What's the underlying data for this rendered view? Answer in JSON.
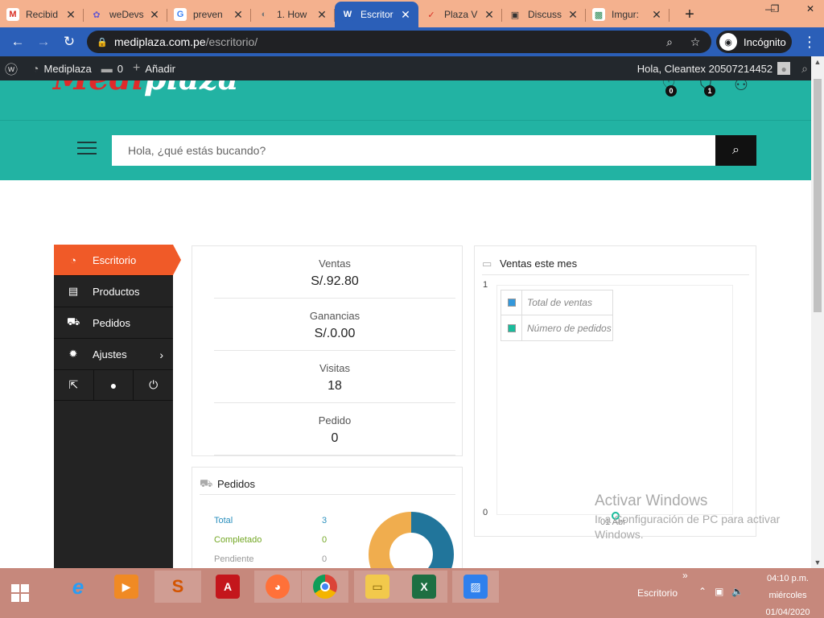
{
  "browser": {
    "tabs": [
      {
        "title": "Recibid",
        "icon": "M",
        "icon_color": "#d93025",
        "icon_bg": "#ffffff",
        "active": false
      },
      {
        "title": "weDevs",
        "icon": "✿",
        "icon_color": "#6a5acd",
        "icon_bg": "#f4b18e",
        "active": false
      },
      {
        "title": "preven",
        "icon": "G",
        "icon_color": "#4285f4",
        "icon_bg": "#ffffff",
        "active": false
      },
      {
        "title": "1. How",
        "icon": "◐",
        "icon_color": "#777777",
        "icon_bg": "#f4b18e",
        "active": false
      },
      {
        "title": "Escritor",
        "icon": "W",
        "icon_color": "#ffffff",
        "icon_bg": "#2b5fb8",
        "active": true
      },
      {
        "title": "Plaza V",
        "icon": "✓",
        "icon_color": "#d93025",
        "icon_bg": "#f4b18e",
        "active": false
      },
      {
        "title": "Discuss",
        "icon": "▣",
        "icon_color": "#333333",
        "icon_bg": "#f4b18e",
        "active": false
      },
      {
        "title": "Imgur:",
        "icon": "▩",
        "icon_color": "#2e8b57",
        "icon_bg": "#ffffff",
        "active": false
      }
    ],
    "new_tab": "+",
    "url_host": "mediplaza.com.pe",
    "url_path": "/escritorio/",
    "incognito_label": "Incógnito"
  },
  "adminbar": {
    "site_name": "Mediplaza",
    "comments_count": "0",
    "add_new": "Añadir",
    "greeting": "Hola, Cleantex 20507214452"
  },
  "header": {
    "logo_part1": "Medi",
    "logo_part2": "plaza",
    "wishlist_count": "0",
    "cart_count": "1"
  },
  "search": {
    "placeholder": "Hola, ¿qué estás bucando?"
  },
  "dashboard_nav": {
    "items": [
      {
        "label": "Escritorio",
        "icon": "◔"
      },
      {
        "label": "Productos",
        "icon": "▤"
      },
      {
        "label": "Pedidos",
        "icon": "⛟"
      },
      {
        "label": "Ajustes",
        "icon": "✹"
      }
    ]
  },
  "stats": [
    {
      "label": "Ventas",
      "value": "S/.92.80"
    },
    {
      "label": "Ganancias",
      "value": "S/.0.00"
    },
    {
      "label": "Visitas",
      "value": "18"
    },
    {
      "label": "Pedido",
      "value": "0"
    }
  ],
  "orders": {
    "title": "Pedidos",
    "rows": [
      {
        "label": "Total",
        "value": "3",
        "color": "#2a8fbd"
      },
      {
        "label": "Completado",
        "value": "0",
        "color": "#73a724"
      },
      {
        "label": "Pendiente",
        "value": "0",
        "color": "#999999"
      }
    ],
    "donut": [
      {
        "share": 0.52,
        "color": "#21759b"
      },
      {
        "share": 0.48,
        "color": "#f0ad4e"
      }
    ]
  },
  "sales_chart": {
    "title": "Ventas este mes",
    "y_max_label": "1",
    "y_min_label": "0",
    "x_label": "01 Abr",
    "legend": [
      {
        "label": "Total de ventas",
        "color": "#3498db"
      },
      {
        "label": "Número de pedidos",
        "color": "#1abc9c"
      }
    ]
  },
  "watermark": {
    "title": "Activar Windows",
    "subtitle": "Ir a Configuración de PC para activar Windows."
  },
  "taskbar": {
    "tray_label": "Escritorio",
    "time": "04:10 p.m.",
    "day": "miércoles",
    "date": "01/04/2020"
  }
}
